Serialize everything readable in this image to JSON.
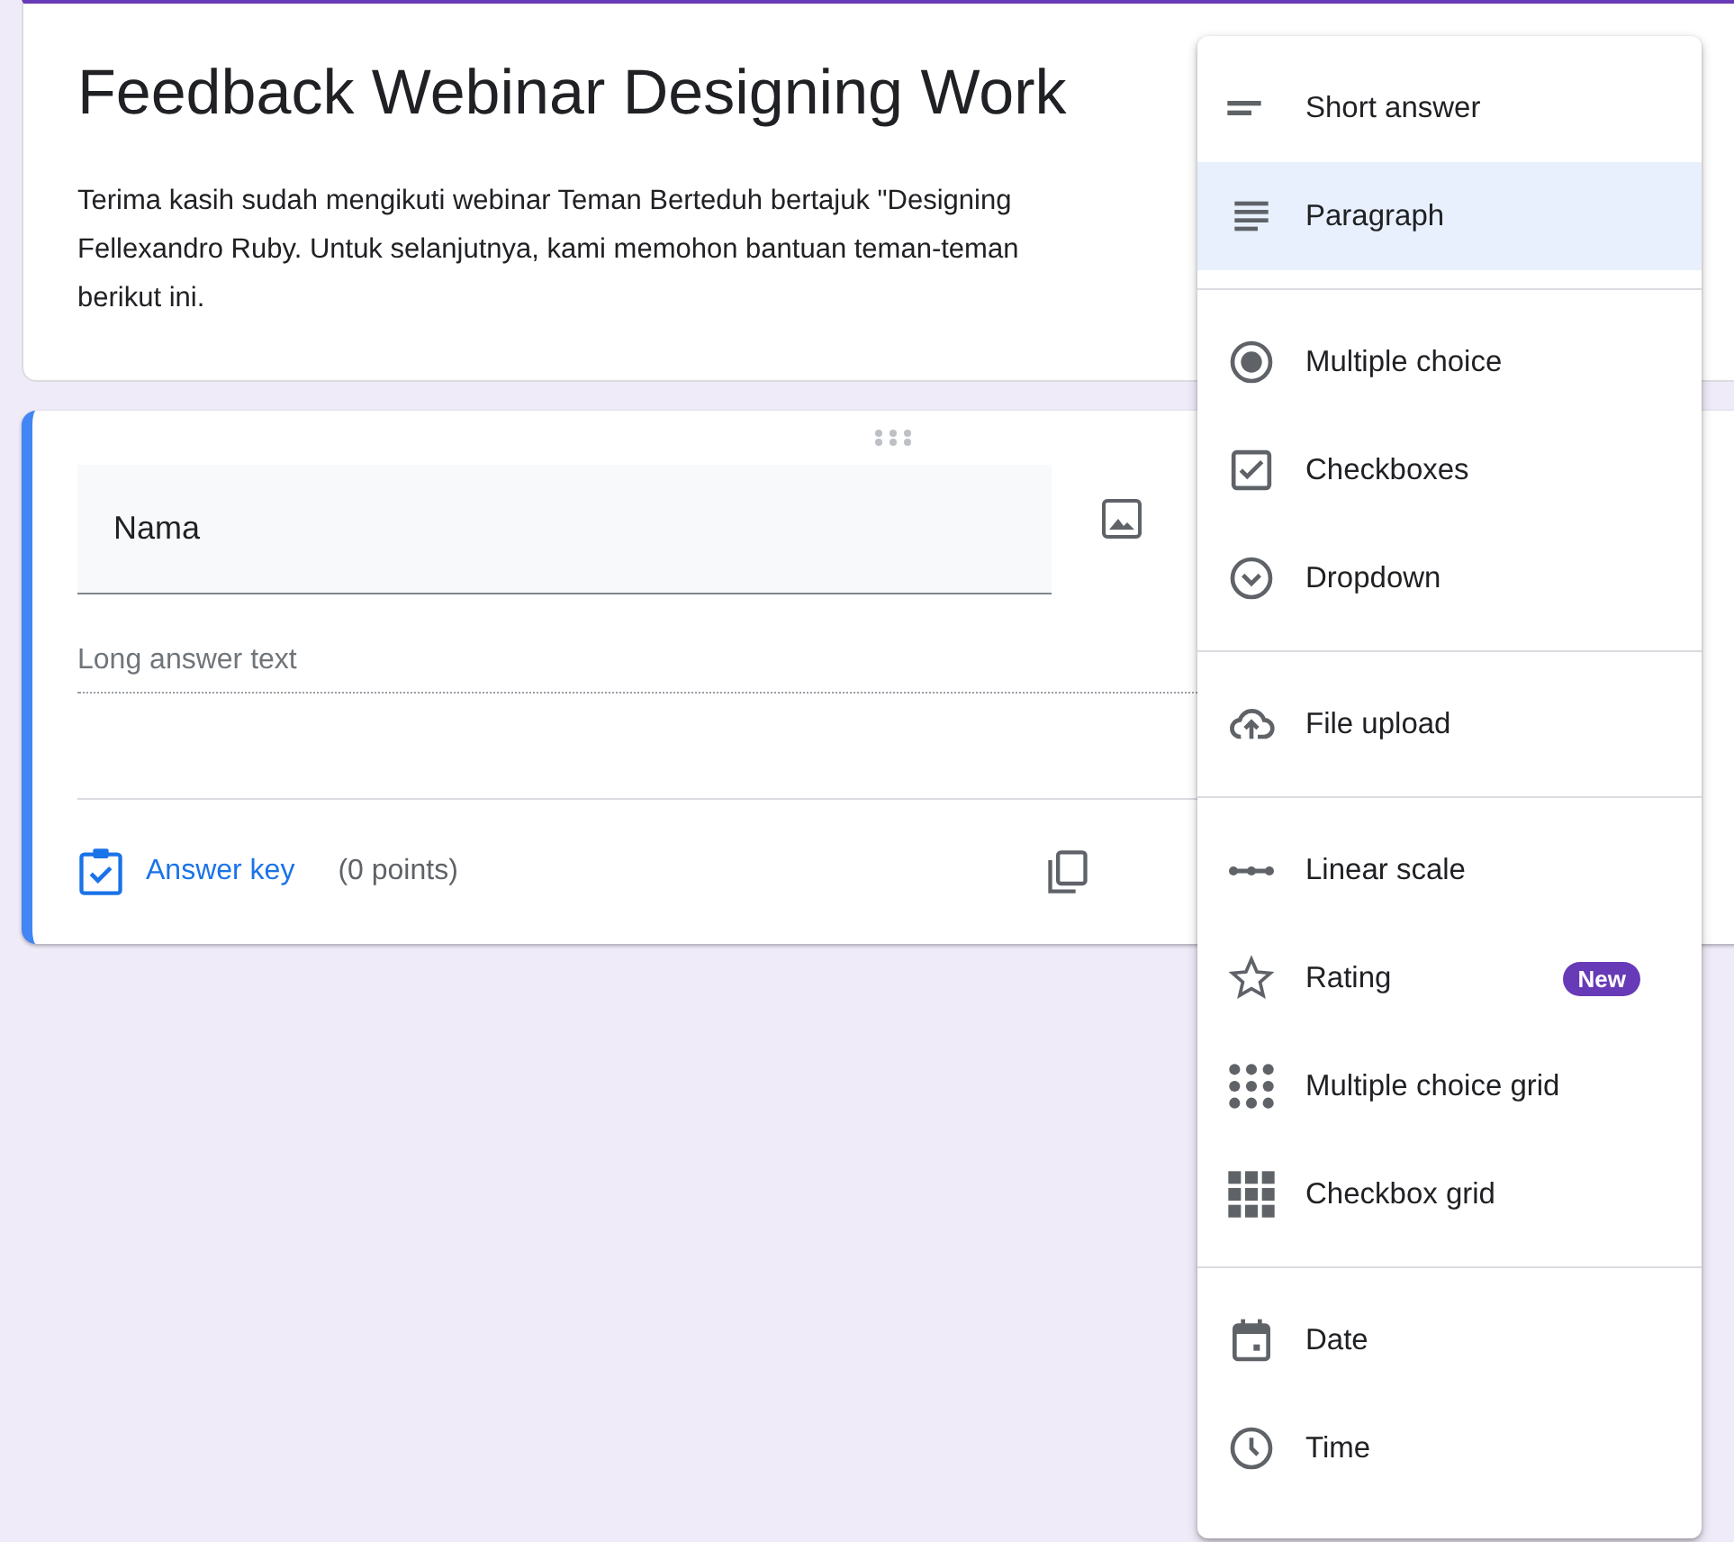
{
  "form_header": {
    "title": "Feedback Webinar Designing Work",
    "description_lines": [
      "Terima kasih sudah mengikuti webinar Teman Berteduh bertajuk \"Designing",
      "Fellexandro Ruby. Untuk selanjutnya, kami memohon bantuan teman-teman",
      "berikut ini."
    ]
  },
  "question": {
    "title": "Nama",
    "answer_placeholder": "Long answer text",
    "answer_key": "Answer key",
    "points": "(0 points)"
  },
  "type_menu": [
    [
      {
        "kind": "short",
        "label": "Short answer",
        "selected": false
      },
      {
        "kind": "paragraph",
        "label": "Paragraph",
        "selected": true
      }
    ],
    [
      {
        "kind": "radio",
        "label": "Multiple choice",
        "selected": false
      },
      {
        "kind": "checkbox",
        "label": "Checkboxes",
        "selected": false
      },
      {
        "kind": "dropdown",
        "label": "Dropdown",
        "selected": false
      }
    ],
    [
      {
        "kind": "upload",
        "label": "File upload",
        "selected": false
      }
    ],
    [
      {
        "kind": "scale",
        "label": "Linear scale",
        "selected": false
      },
      {
        "kind": "star",
        "label": "Rating",
        "selected": false,
        "badge": "New"
      },
      {
        "kind": "dotgrid",
        "label": "Multiple choice grid",
        "selected": false
      },
      {
        "kind": "squaregrid",
        "label": "Checkbox grid",
        "selected": false
      }
    ],
    [
      {
        "kind": "date",
        "label": "Date",
        "selected": false
      },
      {
        "kind": "time",
        "label": "Time",
        "selected": false
      }
    ]
  ]
}
